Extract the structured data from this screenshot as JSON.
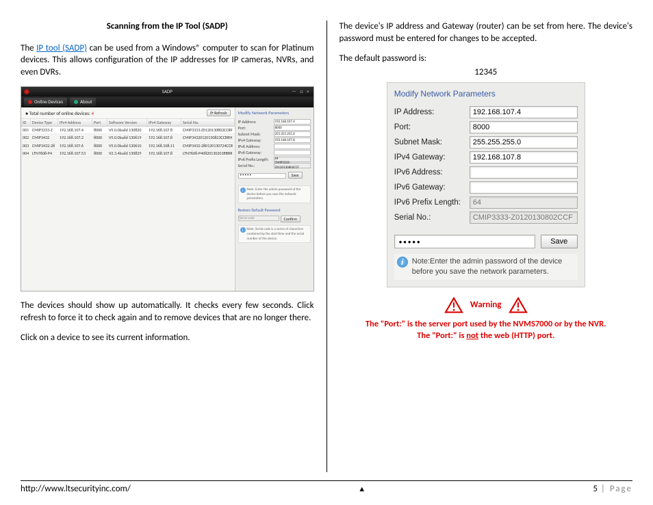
{
  "heading": "Scanning from the IP Tool (SADP)",
  "left": {
    "p1_a": "The ",
    "p1_link": "IP tool (SADP)",
    "p1_b": " can be used from a Windows® computer to scan for Platinum devices.  This allows configuration of the IP addresses for IP cameras, NVRs, and even DVRs.",
    "p2": "The devices should show up automatically.  It checks every few seconds.  Click refresh to force it to check again and to remove devices that are no longer there.",
    "p3": "Click on a device to see its current information."
  },
  "sadp": {
    "title": "SADP",
    "window_controls": "— □ ×",
    "tab_online": "Online Devices",
    "tab_about": "About",
    "total_label": "Total number of online devices:",
    "total_count": "4",
    "refresh": "Refresh",
    "columns": [
      "ID",
      "Device Type",
      "IPv4 Address",
      "Port",
      "Software Version",
      "IPv4 Gateway",
      "Serial No."
    ],
    "rows": [
      {
        "id": "001",
        "type": "CMIP3333-Z",
        "ip": "192.168.107.4",
        "port": "8000",
        "sw": "V5.0.0build 130820",
        "gw": "192.168.107.8",
        "sn": "CMIP3333-Z0120130802CCRF"
      },
      {
        "id": "002",
        "type": "CMIP3432",
        "ip": "192.168.107.2",
        "port": "8000",
        "sw": "V5.0.0build 130619",
        "gw": "192.168.107.8",
        "sn": "CMIP34320120130823CCRRH"
      },
      {
        "id": "003",
        "type": "CMIP3432-28",
        "ip": "192.168.107.6",
        "port": "8000",
        "sw": "V5.0.0build 130610",
        "gw": "192.168.108.11",
        "sn": "CMIP3432-280120130724CCR"
      },
      {
        "id": "004",
        "type": "LTN7608-P4",
        "ip": "192.168.107.53",
        "port": "8000",
        "sw": "V2.3.4build 130829",
        "gw": "192.168.107.8",
        "sn": "LTN7608-P40820130201BBRR"
      }
    ],
    "side": {
      "title": "Modify Network Parameters",
      "ip_lbl": "IP Address:",
      "ip_val": "192.168.107.4",
      "port_lbl": "Port:",
      "port_val": "8000",
      "sm_lbl": "Subnet Mask:",
      "sm_val": "255.255.255.0",
      "gw_lbl": "IPv4 Gateway:",
      "gw_val": "192.168.107.8",
      "ip6a_lbl": "IPv6 Address:",
      "ip6g_lbl": "IPv6 Gateway:",
      "pl_lbl": "IPv6 Prefix Length:",
      "pl_val": "64",
      "sn_lbl": "Serial No.:",
      "sn_val": "CMIP3333-Z0120130802CCF",
      "save": "Save",
      "note": "Note: Enter the admin password of the device before you save the network parameters.",
      "restore": "Restore Default Password",
      "serial_ph": "Serial code",
      "confirm": "Confirm",
      "note2": "Note: Serial code is a series of characters combined by the start time and the serial number of the device."
    }
  },
  "right": {
    "p1": "The device's IP address and Gateway (router) can be set from here. The device's password must be entered for changes to be accepted.",
    "p2": "The default password is:",
    "default_pw": "12345"
  },
  "mnp": {
    "title": "Modify Network Parameters",
    "rows": {
      "ip": {
        "lbl": "IP Address:",
        "val": "192.168.107.4"
      },
      "port": {
        "lbl": "Port:",
        "val": "8000"
      },
      "sm": {
        "lbl": "Subnet Mask:",
        "val": "255.255.255.0"
      },
      "gw": {
        "lbl": "IPv4 Gateway:",
        "val": "192.168.107.8"
      },
      "ip6a": {
        "lbl": "IPv6 Address:",
        "val": ""
      },
      "ip6g": {
        "lbl": "IPv6 Gateway:",
        "val": ""
      },
      "pl": {
        "lbl": "IPv6 Prefix Length:",
        "val": "64"
      },
      "sn": {
        "lbl": "Serial No.:",
        "val": "CMIP3333-Z0120130802CCF"
      }
    },
    "pw_mask": "•••••",
    "save": "Save",
    "note": "Note:Enter the admin password of the device before you save the network parameters."
  },
  "warning": {
    "label": "Warning",
    "line1": "The \"Port:\" is the server port used by the NVMS7000 or by the NVR.",
    "line2a": "The \"Port:\" is ",
    "line2_not": "not",
    "line2b": " the web (HTTP) port."
  },
  "footer": {
    "url": "http://www.ltsecurityinc.com/",
    "tri": "▲",
    "page_num": "5",
    "page_sep": " | ",
    "page_word": "Page"
  }
}
